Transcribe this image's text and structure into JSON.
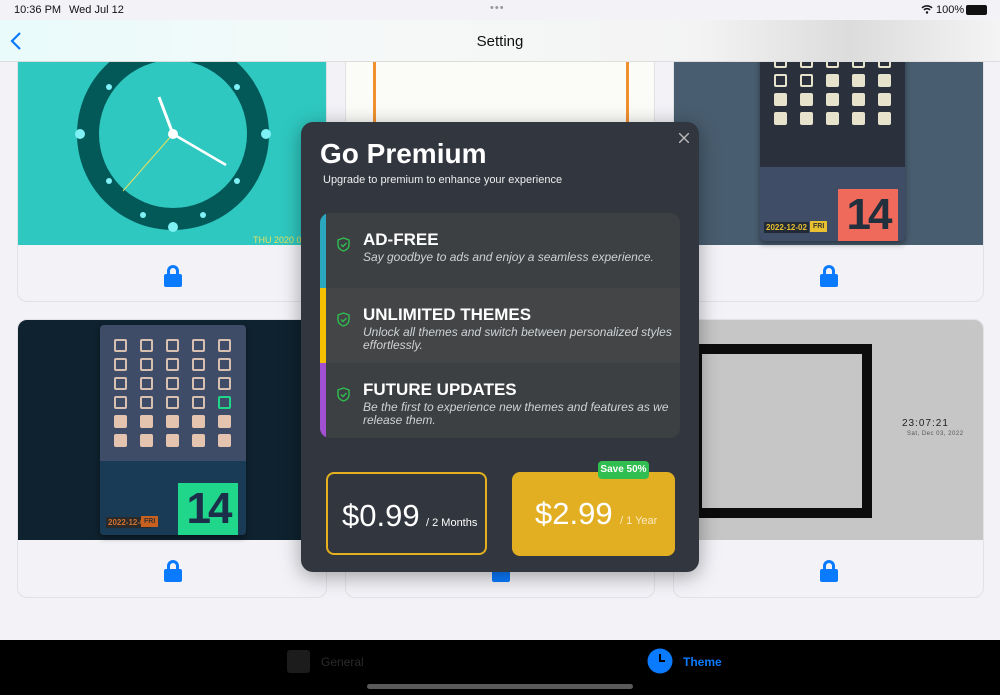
{
  "status": {
    "time": "10:36 PM",
    "date": "Wed Jul 12",
    "battery": "100%",
    "dots": "•••"
  },
  "nav": {
    "title": "Setting",
    "back_icon": "chevron-left-icon"
  },
  "themes": [
    {
      "name": "analog-clock",
      "date_text": "THU 2020 0",
      "locked": true
    },
    {
      "name": "minimal-frame",
      "locked": true
    },
    {
      "name": "calendar-red",
      "date": "2022-12-02",
      "weekday": "FRI",
      "day": "14",
      "locked": true
    },
    {
      "name": "calendar-green",
      "date": "2022-12-02",
      "weekday": "FRI",
      "day": "14",
      "locked": true
    },
    {
      "name": "hidden",
      "locked": true
    },
    {
      "name": "frame-clock",
      "time": "23:07:21",
      "date": "Sat, Dec 03, 2022",
      "locked": true
    }
  ],
  "modal": {
    "title": "Go Premium",
    "subtitle": "Upgrade to premium to enhance your experience",
    "features": [
      {
        "title": "AD-FREE",
        "desc": "Say goodbye to ads and enjoy a seamless experience.",
        "color": "#2aa8c0"
      },
      {
        "title": "UNLIMITED THEMES",
        "desc": "Unlock all themes and switch between personalized styles effortlessly.",
        "color": "#f5c000"
      },
      {
        "title": "FUTURE UPDATES",
        "desc": "Be the first to experience new themes and features as we release them.",
        "color": "#a050d0"
      }
    ],
    "plans": [
      {
        "price": "$0.99",
        "period": "/ 2 Months",
        "selected": true
      },
      {
        "price": "$2.99",
        "period": "/ 1 Year",
        "badge": "Save 50%"
      }
    ]
  },
  "tabs": [
    {
      "label": "General",
      "active": false
    },
    {
      "label": "Theme",
      "active": true
    }
  ],
  "colors": {
    "accent": "#0a7aff",
    "gold": "#e2ae22",
    "badge": "#2fbe4f",
    "modal_bg": "#32363e"
  }
}
